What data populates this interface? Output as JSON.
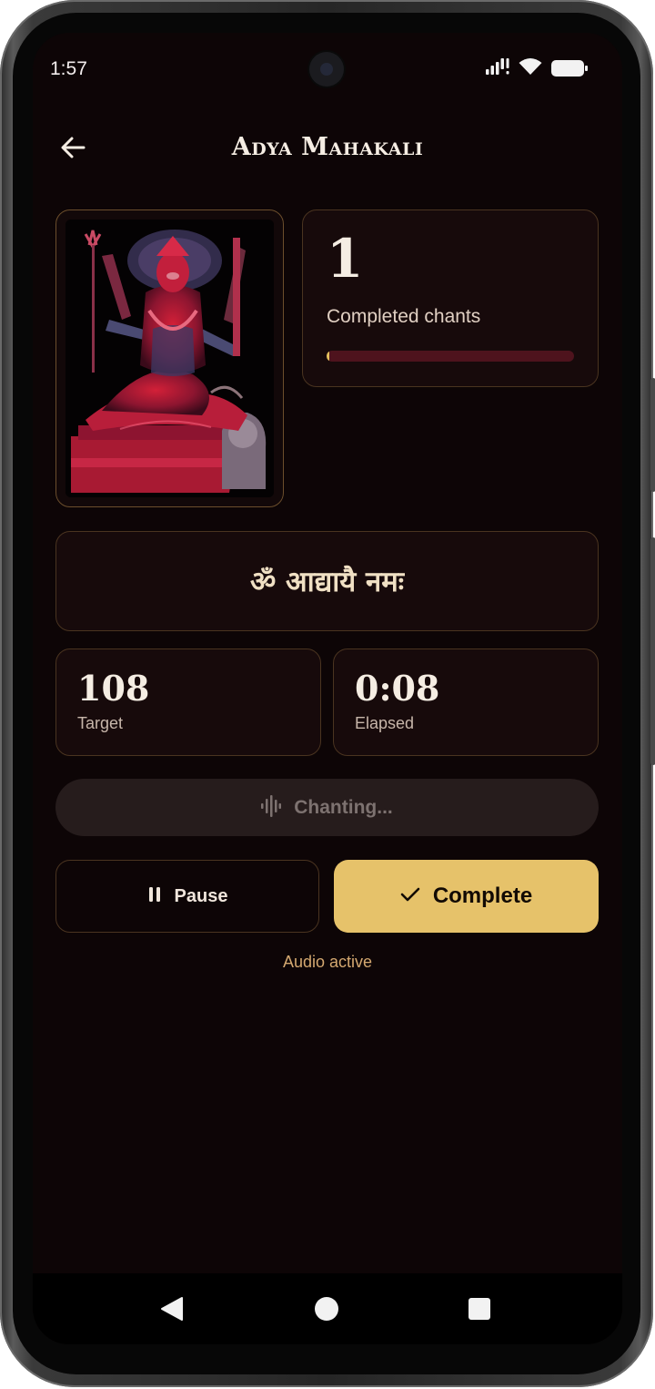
{
  "status_bar": {
    "time": "1:57",
    "icons": [
      "cellular-signal-icon",
      "wifi-icon",
      "battery-icon"
    ]
  },
  "header": {
    "title": "Adya Mahakali",
    "back_icon": "arrow-left-icon"
  },
  "deity_image": {
    "subject": "Adya Mahakali deity statue"
  },
  "counter": {
    "value": "1",
    "label": "Completed chants",
    "progress_fraction": 0.0093
  },
  "mantra": {
    "text": "ॐ आद्यायै नमः"
  },
  "stats": {
    "target": {
      "value": "108",
      "label": "Target"
    },
    "elapsed": {
      "value": "0:08",
      "label": "Elapsed"
    }
  },
  "chanting_status": {
    "label": "Chanting...",
    "icon": "waveform-icon"
  },
  "buttons": {
    "pause": {
      "label": "Pause",
      "icon": "pause-icon"
    },
    "complete": {
      "label": "Complete",
      "icon": "check-icon"
    }
  },
  "audio_status": "Audio active",
  "colors": {
    "background": "#0d0506",
    "card": "#170a0b",
    "card_border": "#4a3420",
    "accent_gold": "#e6c26a",
    "progress_track": "#4e131d",
    "audio_status_text": "#d4a870"
  },
  "nav_bar": {
    "icons": [
      "nav-back-icon",
      "nav-home-icon",
      "nav-recents-icon"
    ]
  }
}
